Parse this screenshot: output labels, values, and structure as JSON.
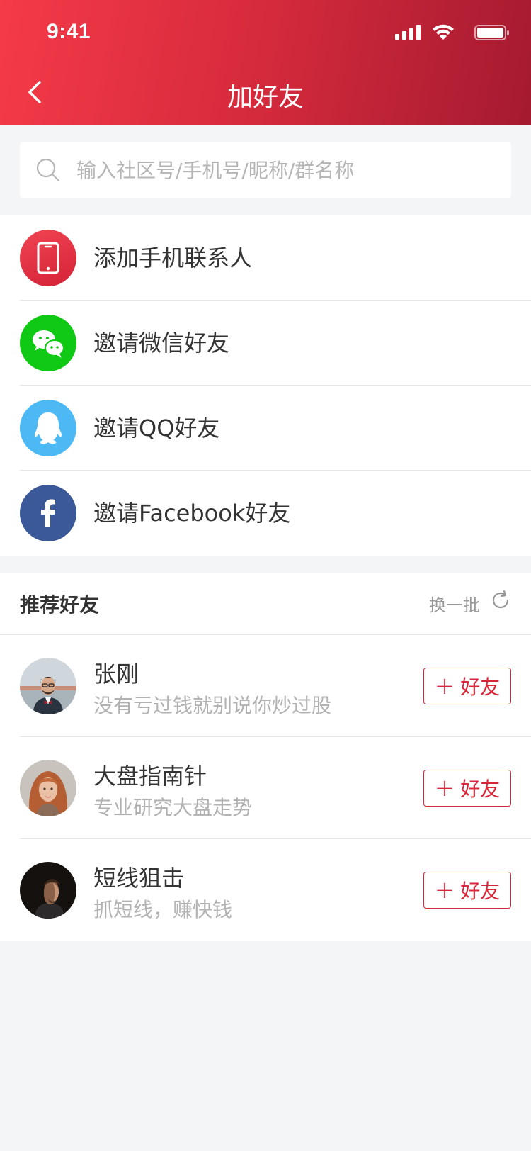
{
  "status_bar": {
    "time": "9:41"
  },
  "nav": {
    "title": "加好友"
  },
  "search": {
    "placeholder": "输入社区号/手机号/昵称/群名称"
  },
  "invite_items": [
    {
      "label": "添加手机联系人",
      "icon": "phone-icon",
      "color": "#e5303f"
    },
    {
      "label": "邀请微信好友",
      "icon": "wechat-icon",
      "color": "#0fc915"
    },
    {
      "label": "邀请QQ好友",
      "icon": "qq-icon",
      "color": "#4cb9f5"
    },
    {
      "label": "邀请Facebook好友",
      "icon": "facebook-icon",
      "color": "#3b5898"
    }
  ],
  "recommend": {
    "title": "推荐好友",
    "refresh_label": "换一批",
    "users": [
      {
        "name": "张刚",
        "bio": "没有亏过钱就别说你炒过股",
        "button": "好友"
      },
      {
        "name": "大盘指南针",
        "bio": "专业研究大盘走势",
        "button": "好友"
      },
      {
        "name": "短线狙击",
        "bio": "抓短线，赚快钱",
        "button": "好友"
      }
    ]
  },
  "colors": {
    "accent": "#d8273a",
    "header_start": "#f53a48",
    "header_end": "#a51a30"
  }
}
